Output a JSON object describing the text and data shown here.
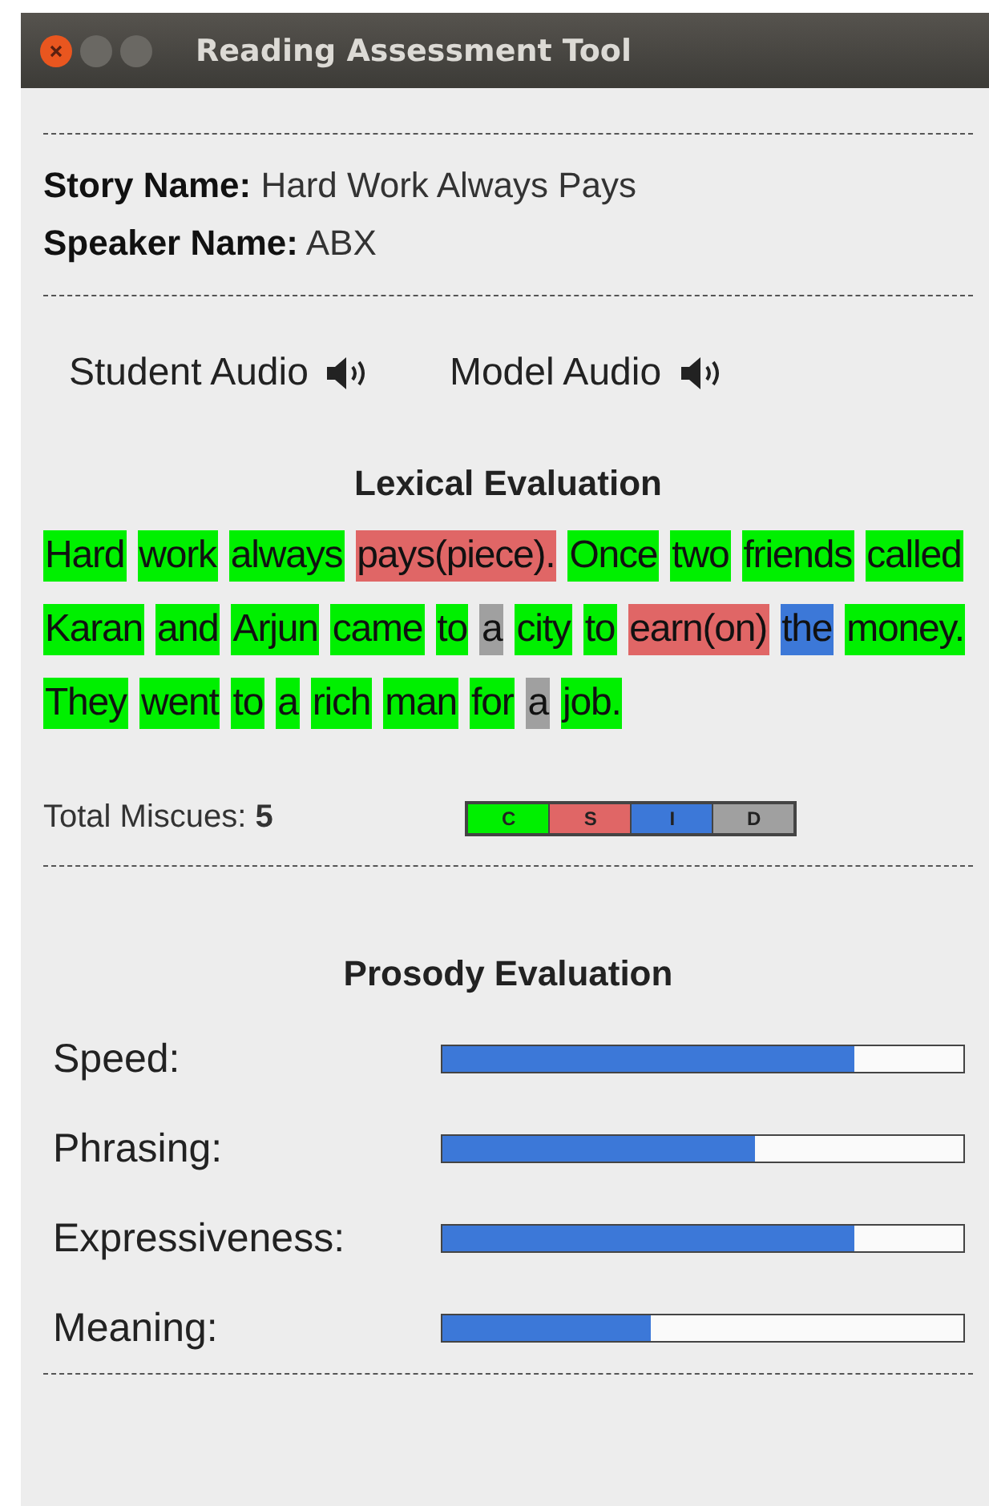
{
  "window": {
    "title": "Reading Assessment Tool"
  },
  "story": {
    "label": "Story Name:",
    "value": "Hard Work Always Pays"
  },
  "speaker": {
    "label": "Speaker Name:",
    "value": "ABX"
  },
  "audio": [
    {
      "label": "Student Audio"
    },
    {
      "label": "Model Audio"
    }
  ],
  "lexical": {
    "title": "Lexical Evaluation",
    "words": [
      {
        "text": "Hard",
        "kind": "correct"
      },
      {
        "text": "work",
        "kind": "correct"
      },
      {
        "text": "always",
        "kind": "correct"
      },
      {
        "text": "pays(piece).",
        "kind": "substitution"
      },
      {
        "text": "Once",
        "kind": "correct"
      },
      {
        "text": "two",
        "kind": "correct"
      },
      {
        "text": "friends",
        "kind": "correct"
      },
      {
        "text": "called",
        "kind": "correct"
      },
      {
        "text": "Karan",
        "kind": "correct"
      },
      {
        "text": "and",
        "kind": "correct"
      },
      {
        "text": "Arjun",
        "kind": "correct"
      },
      {
        "text": "came",
        "kind": "correct"
      },
      {
        "text": "to",
        "kind": "correct"
      },
      {
        "text": "a",
        "kind": "deletion"
      },
      {
        "text": "city",
        "kind": "correct"
      },
      {
        "text": "to",
        "kind": "correct"
      },
      {
        "text": "earn(on)",
        "kind": "substitution"
      },
      {
        "text": "the",
        "kind": "insertion"
      },
      {
        "text": "money.",
        "kind": "correct"
      },
      {
        "text": "They",
        "kind": "correct"
      },
      {
        "text": "went",
        "kind": "correct"
      },
      {
        "text": "to",
        "kind": "correct"
      },
      {
        "text": "a",
        "kind": "correct"
      },
      {
        "text": "rich",
        "kind": "correct"
      },
      {
        "text": "man",
        "kind": "correct"
      },
      {
        "text": "for",
        "kind": "correct"
      },
      {
        "text": "a",
        "kind": "deletion"
      },
      {
        "text": "job.",
        "kind": "correct"
      }
    ],
    "total_label": "Total Miscues:",
    "total_value": "5",
    "legend": [
      {
        "label": "C",
        "kind": "correct"
      },
      {
        "label": "S",
        "kind": "substitution"
      },
      {
        "label": "I",
        "kind": "insertion"
      },
      {
        "label": "D",
        "kind": "deletion"
      }
    ]
  },
  "prosody": {
    "title": "Prosody Evaluation",
    "metrics": [
      {
        "label": "Speed:",
        "level": 0.79
      },
      {
        "label": "Phrasing:",
        "level": 0.6
      },
      {
        "label": "Expressiveness:",
        "level": 0.79
      },
      {
        "label": "Meaning:",
        "level": 0.4
      }
    ]
  }
}
